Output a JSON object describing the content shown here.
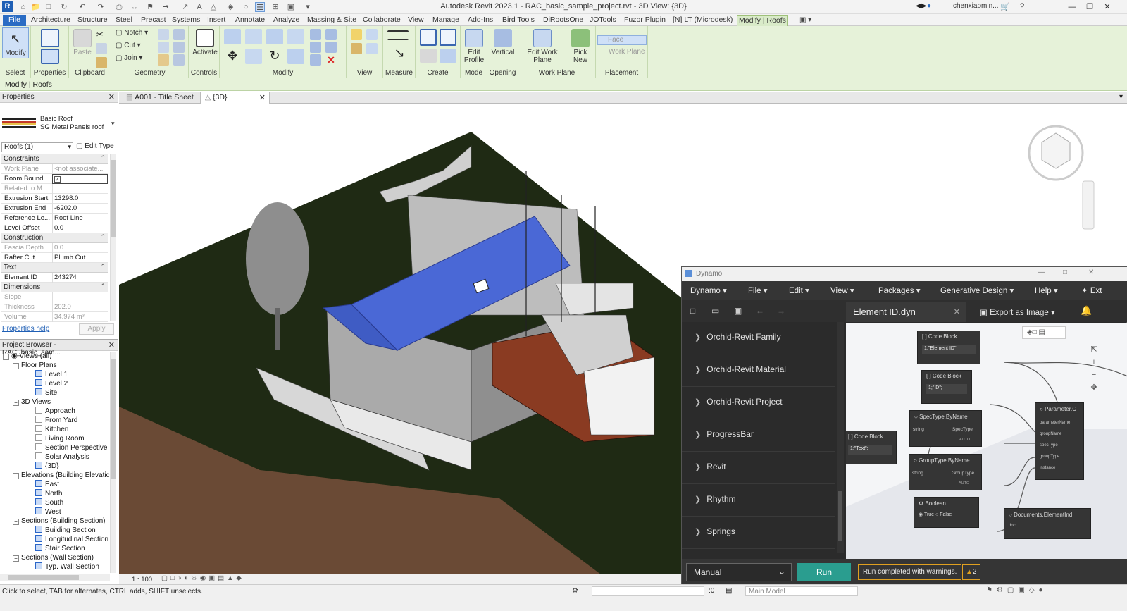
{
  "app": {
    "title": "Autodesk Revit 2023.1 - RAC_basic_sample_project.rvt - 3D View: {3D}",
    "user": "chenxiaomin...",
    "logo": "R"
  },
  "ribbon_tabs": [
    "File",
    "Architecture",
    "Structure",
    "Steel",
    "Precast",
    "Systems",
    "Insert",
    "Annotate",
    "Analyze",
    "Massing & Site",
    "Collaborate",
    "View",
    "Manage",
    "Add-Ins",
    "Bird Tools",
    "DiRootsOne",
    "JOTools",
    "Fuzor Plugin",
    "[N] LT (Microdesk)",
    "Modify | Roofs"
  ],
  "ribbon": {
    "modify_label": "Modify",
    "select_label": "Select",
    "properties_label": "Properties",
    "clipboard_label": "Clipboard",
    "paste_label": "Paste",
    "notch": "Notch",
    "cut": "Cut",
    "join": "Join",
    "geometry_label": "Geometry",
    "activate": "Activate",
    "controls_label": "Controls",
    "modify_group_label": "Modify",
    "view_group_label": "View",
    "measure_label": "Measure",
    "create_label": "Create",
    "edit_profile": "Edit Profile",
    "mode_label": "Mode",
    "vertical": "Vertical",
    "opening_label": "Opening",
    "edit_work_plane": "Edit Work Plane",
    "work_plane_label": "Work Plane",
    "pick_new": "Pick New",
    "face": "Face",
    "work_plane_btn": "Work Plane",
    "placement_label": "Placement"
  },
  "context_bar": "Modify | Roofs",
  "properties": {
    "title": "Properties",
    "type_family": "Basic Roof",
    "type_name": "SG Metal Panels roof",
    "filter": "Roofs (1)",
    "edit_type": "Edit Type",
    "sections": {
      "constraints": "Constraints",
      "construction": "Construction",
      "text": "Text",
      "dimensions": "Dimensions"
    },
    "rows": {
      "work_plane": {
        "k": "Work Plane",
        "v": "<not associate..."
      },
      "room_bounding": {
        "k": "Room Boundi...",
        "v": "✓"
      },
      "related": {
        "k": "Related to M...",
        "v": ""
      },
      "ext_start": {
        "k": "Extrusion Start",
        "v": "13298.0"
      },
      "ext_end": {
        "k": "Extrusion End",
        "v": "-6202.0"
      },
      "ref_level": {
        "k": "Reference Le...",
        "v": "Roof Line"
      },
      "level_offset": {
        "k": "Level Offset",
        "v": "0.0"
      },
      "fascia": {
        "k": "Fascia Depth",
        "v": "0.0"
      },
      "rafter": {
        "k": "Rafter Cut",
        "v": "Plumb Cut"
      },
      "element_id": {
        "k": "Element ID",
        "v": "243274"
      },
      "slope": {
        "k": "Slope",
        "v": ""
      },
      "thickness": {
        "k": "Thickness",
        "v": "202.0"
      },
      "volume": {
        "k": "Volume",
        "v": "34.974 m³"
      }
    },
    "help": "Properties help",
    "apply": "Apply"
  },
  "browser": {
    "title": "Project Browser - RAC_basic_sam...",
    "views_all": "Views (all)",
    "floor_plans": "Floor Plans",
    "fp": [
      "Level 1",
      "Level 2",
      "Site"
    ],
    "views3d": "3D Views",
    "v3": [
      "Approach",
      "From Yard",
      "Kitchen",
      "Living Room",
      "Section Perspective",
      "Solar Analysis",
      "{3D}"
    ],
    "elevations": "Elevations (Building Elevatic",
    "el": [
      "East",
      "North",
      "South",
      "West"
    ],
    "sections": "Sections (Building Section)",
    "sec": [
      "Building Section",
      "Longitudinal Section",
      "Stair Section"
    ],
    "wall_sections": "Sections (Wall Section)",
    "ws": [
      "Typ. Wall Section"
    ]
  },
  "view_tabs": [
    {
      "label": "A001 - Title Sheet"
    },
    {
      "label": "{3D}"
    }
  ],
  "view_scale": "1 : 100",
  "dynamo": {
    "window_title": "Dynamo",
    "menu": [
      "Dynamo",
      "File",
      "Edit",
      "View",
      "Packages",
      "Generative Design",
      "Help",
      "Ext"
    ],
    "file_tab": "Element ID.dyn",
    "export": "Export as Image",
    "library": [
      "Orchid-Revit Family",
      "Orchid-Revit Material",
      "Orchid-Revit Project",
      "ProgressBar",
      "Revit",
      "Rhythm",
      "Springs"
    ],
    "nodes": {
      "cb1": {
        "title": "Code Block",
        "code": "1;\"Element ID\";"
      },
      "cb2": {
        "title": "Code Block",
        "code": "1;\"ID\";"
      },
      "cb3": {
        "title": "Code Block",
        "code": "1;\"Text\";"
      },
      "spec": {
        "title": "SpecType.ByName",
        "in": "string",
        "out": "SpecType",
        "lacing": "AUTO"
      },
      "group": {
        "title": "GroupType.ByName",
        "in": "string",
        "out": "GroupType",
        "lacing": "AUTO"
      },
      "bool": {
        "title": "Boolean",
        "true": "True",
        "false": "False"
      },
      "param": {
        "title": "Parameter.C",
        "ports": [
          "parameterName",
          "groupName",
          "specType",
          "groupType",
          "instance"
        ]
      },
      "docs": {
        "title": "Documents.ElementInd",
        "port": "doc"
      }
    },
    "run_mode": "Manual",
    "run": "Run",
    "run_status": "Run completed with warnings.",
    "warnings": "2"
  },
  "status": {
    "hint": "Click to select, TAB for alternates, CTRL adds, SHIFT unselects.",
    "zero": ":0",
    "model": "Main Model"
  }
}
